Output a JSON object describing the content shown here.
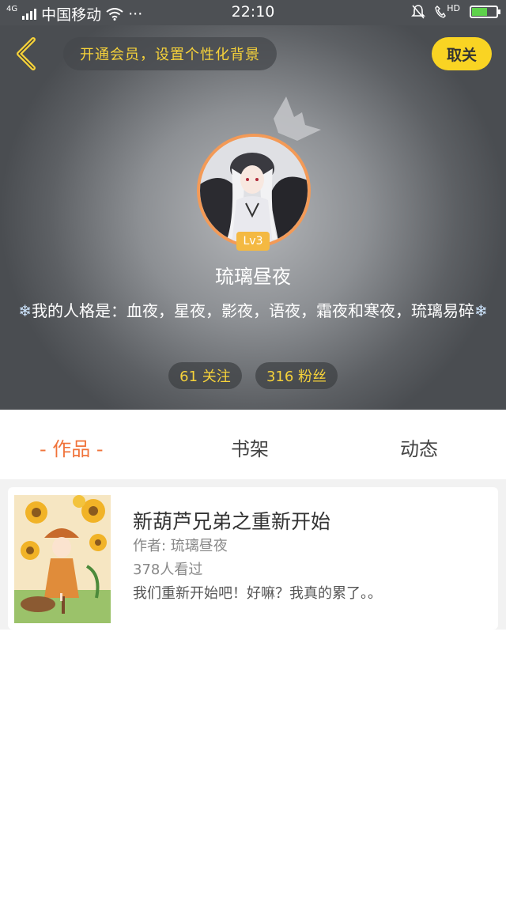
{
  "status_bar": {
    "network": "4G",
    "carrier": "中国移动",
    "more": "···",
    "time": "22:10",
    "hd": "HD",
    "battery_level": 0.6
  },
  "header": {
    "vip_prompt": "开通会员，设置个性化背景",
    "cancel_label": "取关",
    "level": "Lv3",
    "username": "琉璃昼夜",
    "bio_text": "我的人格是：血夜，星夜，影夜，语夜，霜夜和寒夜，琉璃易碎",
    "bio_icon": "❄",
    "following_label": "61 关注",
    "followers_label": "316 粉丝"
  },
  "tabs": [
    {
      "label": "- 作品 -",
      "active": true
    },
    {
      "label": "书架",
      "active": false
    },
    {
      "label": "动态",
      "active": false
    }
  ],
  "works": [
    {
      "title": "新葫芦兄弟之重新开始",
      "author": "作者: 琉璃昼夜",
      "views": "378人看过",
      "description": "我们重新开始吧！好嘛？我真的累了。。"
    }
  ],
  "colors": {
    "accent": "#f0733a",
    "yellow": "#f9d423",
    "avatar_border": "#f39a57"
  }
}
